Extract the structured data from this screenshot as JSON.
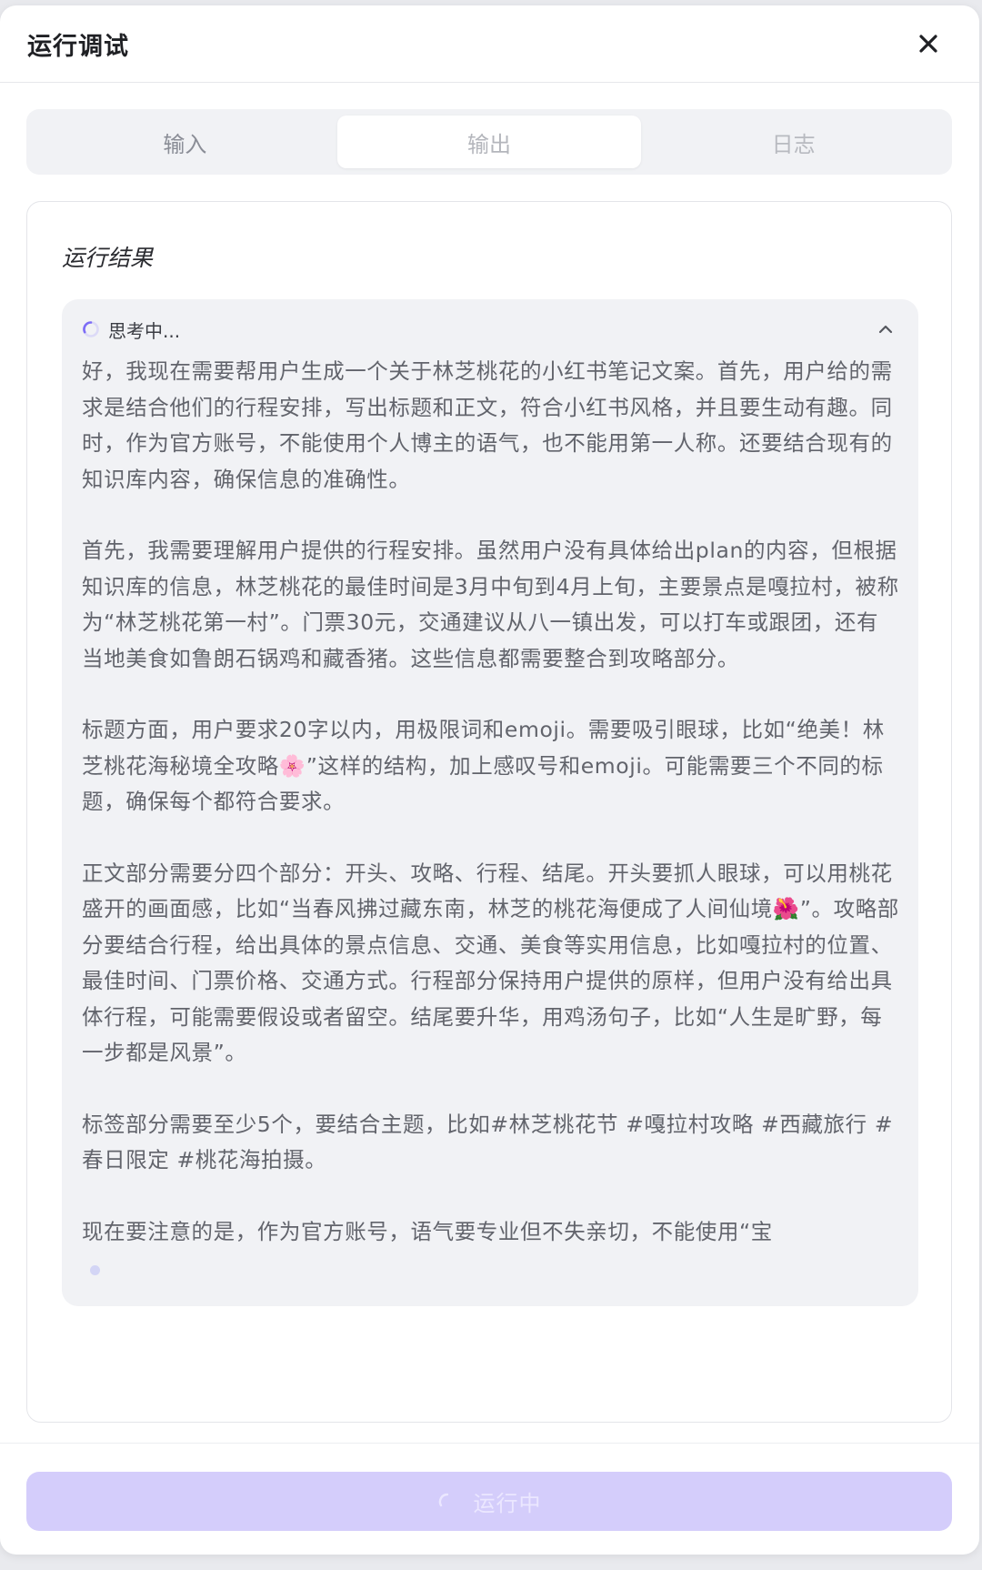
{
  "modal": {
    "title": "运行调试",
    "close_icon": "close-icon"
  },
  "tabs": [
    {
      "label": "输入",
      "state": "normal"
    },
    {
      "label": "输出",
      "state": "active"
    },
    {
      "label": "日志",
      "state": "dim"
    }
  ],
  "result": {
    "label": "运行结果",
    "thinking": {
      "status": "思考中...",
      "status_icon": "loading-spinner-icon",
      "collapse_icon": "chevron-up-icon",
      "paragraphs": [
        "好，我现在需要帮用户生成一个关于林芝桃花的小红书笔记文案。首先，用户给的需求是结合他们的行程安排，写出标题和正文，符合小红书风格，并且要生动有趣。同时，作为官方账号，不能使用个人博主的语气，也不能用第一人称。还要结合现有的知识库内容，确保信息的准确性。",
        "首先，我需要理解用户提供的行程安排。虽然用户没有具体给出plan的内容，但根据知识库的信息，林芝桃花的最佳时间是3月中旬到4月上旬，主要景点是嘎拉村，被称为“林芝桃花第一村”。门票30元，交通建议从八一镇出发，可以打车或跟团，还有当地美食如鲁朗石锅鸡和藏香猪。这些信息都需要整合到攻略部分。",
        "标题方面，用户要求20字以内，用极限词和emoji。需要吸引眼球，比如“绝美！林芝桃花海秘境全攻略🌸”这样的结构，加上感叹号和emoji。可能需要三个不同的标题，确保每个都符合要求。",
        "正文部分需要分四个部分：开头、攻略、行程、结尾。开头要抓人眼球，可以用桃花盛开的画面感，比如“当春风拂过藏东南，林芝的桃花海便成了人间仙境🌺”。攻略部分要结合行程，给出具体的景点信息、交通、美食等实用信息，比如嘎拉村的位置、最佳时间、门票价格、交通方式。行程部分保持用户提供的原样，但用户没有给出具体行程，可能需要假设或者留空。结尾要升华，用鸡汤句子，比如“人生是旷野，每一步都是风景”。",
        "标签部分需要至少5个，要结合主题，比如#林芝桃花节 #嘎拉村攻略 #西藏旅行 #春日限定 #桃花海拍摄。",
        "现在要注意的是，作为官方账号，语气要专业但不失亲切，不能使用“宝"
      ]
    }
  },
  "footer": {
    "run_button_label": "运行中",
    "run_button_icon": "loading-spinner-icon"
  },
  "colors": {
    "accent": "#7c6cf6",
    "run_button_bg": "#d4cdfb",
    "thinking_bg": "#f1f2f5"
  }
}
